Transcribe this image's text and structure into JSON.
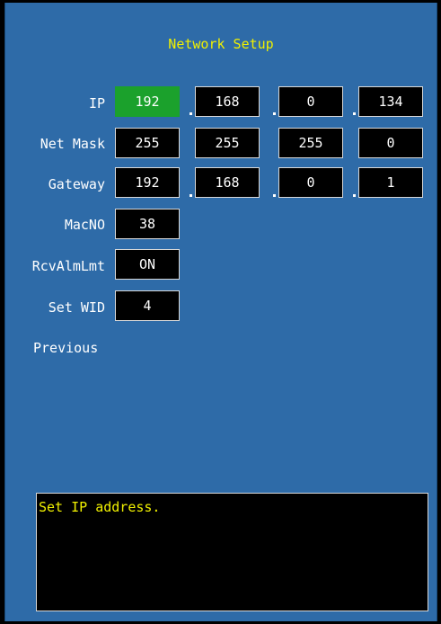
{
  "title": "Network Setup",
  "labels": {
    "ip": "IP",
    "netmask": "Net Mask",
    "gateway": "Gateway",
    "macno": "MacNO",
    "rcvalmlmt": "RcvAlmLmt",
    "setwid": "Set WID",
    "previous": "Previous"
  },
  "ip": [
    "192",
    "168",
    "0",
    "134"
  ],
  "netmask": [
    "255",
    "255",
    "255",
    "0"
  ],
  "gateway": [
    "192",
    "168",
    "0",
    "1"
  ],
  "macno": "38",
  "rcvalmlmt": "ON",
  "setwid": "4",
  "help_text": "Set IP address.",
  "colors": {
    "background": "#2e6ba8",
    "title": "#f0f000",
    "selected_field": "#1ba12c",
    "field_bg": "#000000"
  }
}
